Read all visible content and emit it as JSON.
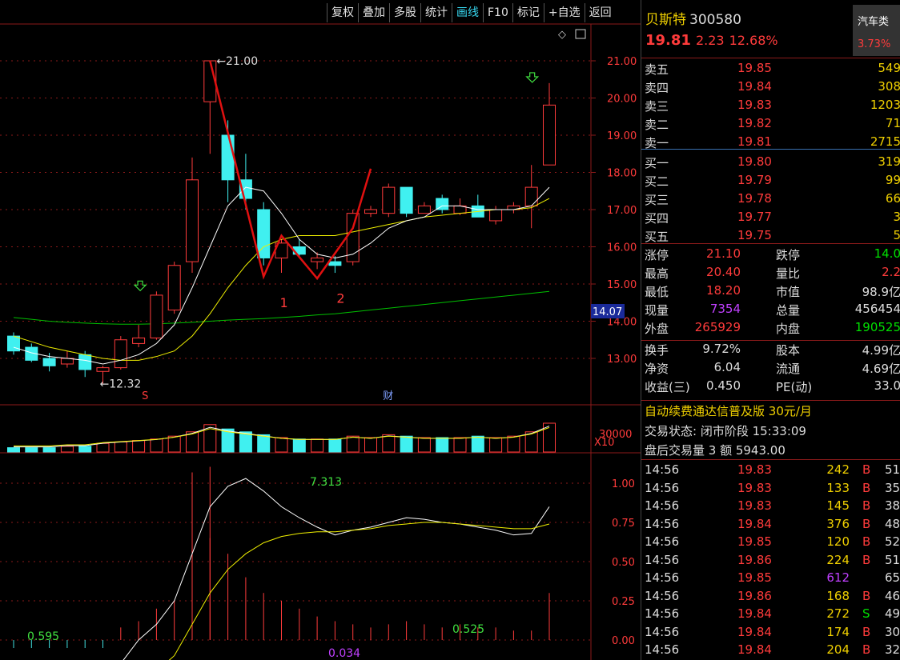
{
  "toolbar": [
    "复权",
    "叠加",
    "多股",
    "统计",
    "画线",
    "F10",
    "标记",
    "+自选",
    "返回"
  ],
  "toolbar_active_index": 4,
  "stock": {
    "name": "贝斯特",
    "code": "300580",
    "price": "19.81",
    "change": "2.23",
    "pct": "12.68%"
  },
  "sector": {
    "name": "汽车类",
    "pct": "3.73%"
  },
  "order_book": [
    {
      "label": "卖五",
      "price": "19.85",
      "vol": "549"
    },
    {
      "label": "卖四",
      "price": "19.84",
      "vol": "308"
    },
    {
      "label": "卖三",
      "price": "19.83",
      "vol": "1203"
    },
    {
      "label": "卖二",
      "price": "19.82",
      "vol": "71"
    },
    {
      "label": "卖一",
      "price": "19.81",
      "vol": "2715"
    },
    {
      "label": "买一",
      "price": "19.80",
      "vol": "319"
    },
    {
      "label": "买二",
      "price": "19.79",
      "vol": "99"
    },
    {
      "label": "买三",
      "price": "19.78",
      "vol": "66"
    },
    {
      "label": "买四",
      "price": "19.77",
      "vol": "3"
    },
    {
      "label": "买五",
      "price": "19.75",
      "vol": "5"
    }
  ],
  "stats": [
    {
      "l1": "涨停",
      "v1": "21.10",
      "l2": "跌停",
      "v2": "14.0"
    },
    {
      "l1": "最高",
      "v1": "20.40",
      "l2": "量比",
      "v2": "2.2"
    },
    {
      "l1": "最低",
      "v1": "18.20",
      "l2": "市值",
      "v2": "98.9亿"
    },
    {
      "l1": "现量",
      "v1": "7354",
      "l2": "总量",
      "v2": "456454"
    },
    {
      "l1": "外盘",
      "v1": "265929",
      "l2": "内盘",
      "v2": "190525"
    },
    {
      "l1": "换手",
      "v1": "9.72%",
      "l2": "股本",
      "v2": "4.99亿"
    },
    {
      "l1": "净资",
      "v1": "6.04",
      "l2": "流通",
      "v2": "4.69亿"
    },
    {
      "l1": "收益(三)",
      "v1": "0.450",
      "l2": "PE(动)",
      "v2": "33.0"
    }
  ],
  "ad_text": "自动续费通达信普及版  30元/月",
  "trade_status": "交易状态: 闭市阶段 15:33:09",
  "after_hours": "盘后交易量 3 额 5943.00",
  "ticks": [
    {
      "t": "14:56",
      "p": "19.83",
      "v": "242",
      "s": "B",
      "n": "51"
    },
    {
      "t": "14:56",
      "p": "19.83",
      "v": "133",
      "s": "B",
      "n": "35"
    },
    {
      "t": "14:56",
      "p": "19.83",
      "v": "145",
      "s": "B",
      "n": "38"
    },
    {
      "t": "14:56",
      "p": "19.84",
      "v": "376",
      "s": "B",
      "n": "48"
    },
    {
      "t": "14:56",
      "p": "19.85",
      "v": "120",
      "s": "B",
      "n": "52"
    },
    {
      "t": "14:56",
      "p": "19.86",
      "v": "224",
      "s": "B",
      "n": "51"
    },
    {
      "t": "14:56",
      "p": "19.85",
      "v": "612",
      "s": "",
      "n": "65"
    },
    {
      "t": "14:56",
      "p": "19.86",
      "v": "168",
      "s": "B",
      "n": "46"
    },
    {
      "t": "14:56",
      "p": "19.84",
      "v": "272",
      "s": "S",
      "n": "49"
    },
    {
      "t": "14:56",
      "p": "19.84",
      "v": "174",
      "s": "B",
      "n": "30"
    },
    {
      "t": "14:56",
      "p": "19.84",
      "v": "204",
      "s": "B",
      "n": "32"
    }
  ],
  "colors": {
    "up": "#ff3b3b",
    "down": "#40f0f0",
    "ma5": "#ffffff",
    "ma10": "#f0f000",
    "ma60": "#00c000",
    "grid": "#8b1a1a"
  },
  "chart_data": {
    "type": "candlestick",
    "price_axis": {
      "ticks": [
        13,
        14,
        15,
        16,
        17,
        18,
        19,
        20,
        21
      ]
    },
    "current_price_marker": "14.07",
    "annotations": {
      "high": "←21.00",
      "low": "←12.32",
      "label_1": "1",
      "label_2": "2",
      "marker_s": "S",
      "marker_cai": "财"
    },
    "candles": [
      {
        "o": 13.6,
        "c": 13.2,
        "h": 13.7,
        "l": 13.1
      },
      {
        "o": 13.3,
        "c": 12.95,
        "h": 13.4,
        "l": 12.9
      },
      {
        "o": 13.0,
        "c": 12.8,
        "h": 13.15,
        "l": 12.65
      },
      {
        "o": 12.85,
        "c": 13.0,
        "h": 13.2,
        "l": 12.75
      },
      {
        "o": 13.1,
        "c": 12.7,
        "h": 13.2,
        "l": 12.5
      },
      {
        "o": 12.65,
        "c": 12.75,
        "h": 12.8,
        "l": 12.32
      },
      {
        "o": 12.75,
        "c": 13.5,
        "h": 13.6,
        "l": 12.7
      },
      {
        "o": 13.4,
        "c": 13.55,
        "h": 13.9,
        "l": 13.3
      },
      {
        "o": 13.55,
        "c": 14.7,
        "h": 14.8,
        "l": 13.5
      },
      {
        "o": 14.3,
        "c": 15.5,
        "h": 15.6,
        "l": 14.2
      },
      {
        "o": 15.6,
        "c": 17.8,
        "h": 18.4,
        "l": 15.3
      },
      {
        "o": 19.9,
        "c": 21.0,
        "h": 21.0,
        "l": 18.5
      },
      {
        "o": 19.0,
        "c": 17.8,
        "h": 19.4,
        "l": 17.2
      },
      {
        "o": 17.8,
        "c": 17.3,
        "h": 18.5,
        "l": 17.0
      },
      {
        "o": 17.0,
        "c": 15.7,
        "h": 17.2,
        "l": 15.5
      },
      {
        "o": 15.7,
        "c": 16.1,
        "h": 16.2,
        "l": 15.3
      },
      {
        "o": 16.0,
        "c": 15.8,
        "h": 16.2,
        "l": 15.7
      },
      {
        "o": 15.6,
        "c": 15.7,
        "h": 15.85,
        "l": 15.4
      },
      {
        "o": 15.6,
        "c": 15.5,
        "h": 15.75,
        "l": 15.3
      },
      {
        "o": 15.6,
        "c": 16.9,
        "h": 17.0,
        "l": 15.5
      },
      {
        "o": 16.9,
        "c": 17.0,
        "h": 17.1,
        "l": 16.8
      },
      {
        "o": 16.9,
        "c": 17.6,
        "h": 17.7,
        "l": 16.8
      },
      {
        "o": 17.6,
        "c": 16.9,
        "h": 17.6,
        "l": 16.8
      },
      {
        "o": 16.9,
        "c": 17.1,
        "h": 17.2,
        "l": 16.9
      },
      {
        "o": 17.3,
        "c": 17.0,
        "h": 17.4,
        "l": 16.9
      },
      {
        "o": 16.9,
        "c": 17.1,
        "h": 17.3,
        "l": 16.85
      },
      {
        "o": 17.1,
        "c": 16.8,
        "h": 17.4,
        "l": 16.8
      },
      {
        "o": 16.7,
        "c": 17.0,
        "h": 17.1,
        "l": 16.6
      },
      {
        "o": 17.0,
        "c": 17.1,
        "h": 17.2,
        "l": 16.9
      },
      {
        "o": 17.1,
        "c": 17.6,
        "h": 18.2,
        "l": 16.5
      },
      {
        "o": 18.2,
        "c": 19.81,
        "h": 20.4,
        "l": 18.2
      }
    ],
    "ma5": [
      13.3,
      13.15,
      13.05,
      13.0,
      12.95,
      12.85,
      12.95,
      13.1,
      13.4,
      13.9,
      14.9,
      16.0,
      17.1,
      17.6,
      17.5,
      16.9,
      16.2,
      15.8,
      15.7,
      15.8,
      16.1,
      16.5,
      16.7,
      16.8,
      17.1,
      17.1,
      17.0,
      17.0,
      17.0,
      17.1,
      17.6
    ],
    "ma10": [
      13.6,
      13.45,
      13.3,
      13.2,
      13.1,
      13.0,
      12.95,
      12.95,
      13.05,
      13.2,
      13.6,
      14.2,
      14.9,
      15.5,
      16.0,
      16.2,
      16.3,
      16.3,
      16.3,
      16.4,
      16.5,
      16.6,
      16.7,
      16.8,
      16.85,
      16.9,
      16.95,
      17.0,
      17.0,
      17.05,
      17.3
    ],
    "ma60": [
      14.1,
      14.05,
      14.0,
      13.97,
      13.95,
      13.93,
      13.92,
      13.92,
      13.93,
      13.95,
      13.97,
      14.0,
      14.03,
      14.05,
      14.07,
      14.1,
      14.13,
      14.17,
      14.2,
      14.25,
      14.3,
      14.35,
      14.4,
      14.45,
      14.5,
      14.55,
      14.6,
      14.65,
      14.7,
      14.75,
      14.8
    ],
    "draw_points": [
      {
        "i": 11,
        "p": 21.0
      },
      {
        "i": 14,
        "p": 15.2
      },
      {
        "i": 15,
        "p": 16.3
      },
      {
        "i": 17,
        "p": 15.15
      },
      {
        "i": 19,
        "p": 16.5
      },
      {
        "i": 20,
        "p": 18.1
      }
    ],
    "volume": {
      "label": "X10",
      "ticks": [
        "30000"
      ],
      "values": [
        0.15,
        0.15,
        0.15,
        0.2,
        0.2,
        0.3,
        0.35,
        0.4,
        0.45,
        0.55,
        0.7,
        0.95,
        0.8,
        0.7,
        0.6,
        0.5,
        0.45,
        0.45,
        0.45,
        0.55,
        0.5,
        0.6,
        0.55,
        0.5,
        0.5,
        0.5,
        0.55,
        0.5,
        0.55,
        0.7,
        1.0
      ]
    },
    "indicator": {
      "ticks": [
        "1.00",
        "0.75",
        "0.50",
        "0.25",
        "0.00"
      ],
      "labels": [
        "7.313",
        "0.595",
        "0.034",
        "0.525"
      ],
      "bars": [
        0.0,
        0.0,
        0.0,
        0.0,
        0.0,
        0.0,
        0.08,
        0.12,
        0.2,
        0.25,
        0.4,
        0.65,
        0.55,
        0.4,
        0.3,
        0.25,
        0.2,
        0.15,
        0.12,
        0.1,
        0.08,
        0.1,
        0.12,
        0.1,
        0.08,
        0.1,
        0.08,
        0.08,
        0.06,
        0.06,
        0.3
      ],
      "line1": [
        -0.3,
        -0.3,
        -0.3,
        -0.3,
        -0.3,
        -0.3,
        -0.15,
        0.0,
        0.1,
        0.25,
        0.55,
        0.85,
        0.98,
        1.03,
        0.95,
        0.85,
        0.78,
        0.72,
        0.67,
        0.7,
        0.72,
        0.75,
        0.78,
        0.77,
        0.75,
        0.74,
        0.72,
        0.7,
        0.67,
        0.68,
        0.85
      ],
      "line2": [
        -0.3,
        -0.3,
        -0.3,
        -0.3,
        -0.3,
        -0.3,
        -0.3,
        -0.3,
        -0.2,
        -0.1,
        0.1,
        0.3,
        0.45,
        0.55,
        0.62,
        0.66,
        0.68,
        0.69,
        0.69,
        0.7,
        0.71,
        0.73,
        0.74,
        0.75,
        0.75,
        0.74,
        0.73,
        0.72,
        0.71,
        0.71,
        0.74
      ]
    }
  }
}
